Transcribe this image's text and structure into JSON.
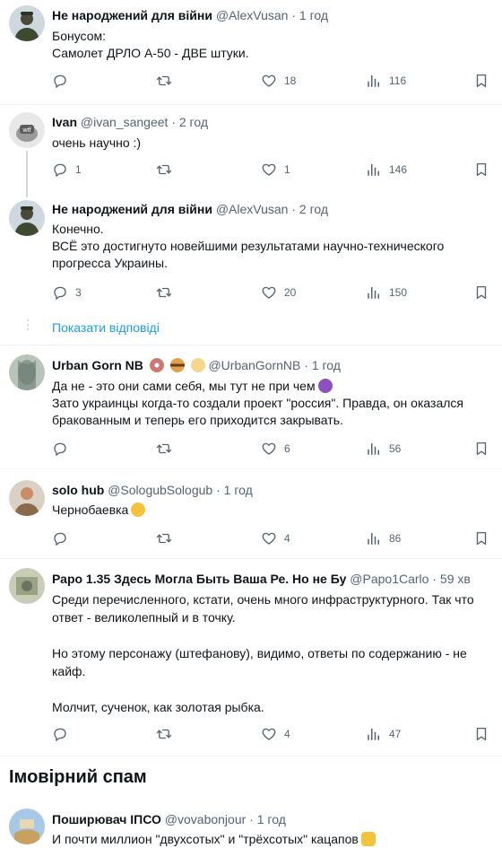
{
  "tweets": [
    {
      "name": "Не народжений для війни",
      "handle": "@AlexVusan",
      "time": "1 год",
      "lines": [
        "Бонусом:",
        "Самолет ДРЛО А-50 - ДВЕ штуки."
      ],
      "replies": "",
      "retweets": "",
      "likes": "18",
      "views": "116"
    },
    {
      "name": "Ivan",
      "handle": "@ivan_sangeet",
      "time": "2 год",
      "lines": [
        "очень научно :)"
      ],
      "replies": "1",
      "retweets": "",
      "likes": "1",
      "views": "146"
    },
    {
      "name": "Не народжений для війни",
      "handle": "@AlexVusan",
      "time": "2 год",
      "lines": [
        "Конечно.",
        "ВСЁ это достигнуто новейшими результатами научно-технического",
        "прогресса Украины."
      ],
      "replies": "3",
      "retweets": "",
      "likes": "20",
      "views": "150"
    },
    {
      "name": "Urban Gorn NB",
      "handle": "@UrbanGornNB",
      "time": "1 год",
      "lines": [
        "Да не - это они сами себя, мы тут не при чем",
        "Зато украинцы когда-то создали проект \"россия\". Правда, он оказался",
        "бракованным и теперь его приходится закрывать."
      ],
      "replies": "",
      "retweets": "",
      "likes": "6",
      "views": "56"
    },
    {
      "name": "solo hub",
      "handle": "@SologubSologub",
      "time": "1 год",
      "lines": [
        "Чернобаевка"
      ],
      "replies": "",
      "retweets": "",
      "likes": "4",
      "views": "86"
    },
    {
      "name": "Раро 1.35 Здесь Могла Быть Ваша Ре. Но не Бу",
      "handle": "@Papo1Carlo",
      "time": "59 хв",
      "lines": [
        "Среди перечисленного, кстати, очень много инфраструктурного. Так что",
        "ответ - великолепный и в точку.",
        "",
        "Но этому персонажу (штефанову), видимо, ответы по содержанию - не",
        "кайф.",
        "",
        "Молчит, сученок, как золотая рыбка."
      ],
      "replies": "",
      "retweets": "",
      "likes": "4",
      "views": "47"
    },
    {
      "name": "Поширювач ІПСО",
      "handle": "@vovabonjour",
      "time": "1 год",
      "lines": [
        "И почти миллион \"двухсотых\" и \"трёхсотых\" кацапов"
      ]
    }
  ],
  "show_replies": "Показати відповіді",
  "spam_section_title": "Імовірний спам",
  "sep": "·",
  "icons": {
    "reply": "reply-icon",
    "retweet": "retweet-icon",
    "like": "heart-icon",
    "views": "views-icon",
    "bookmark": "bookmark-icon"
  },
  "colors": {
    "link": "#1d9bf0",
    "muted": "#536471",
    "text": "#0f1419"
  }
}
